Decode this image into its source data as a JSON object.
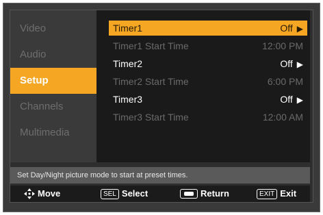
{
  "menu": {
    "items": [
      {
        "label": "Video",
        "active": false
      },
      {
        "label": "Audio",
        "active": false
      },
      {
        "label": "Setup",
        "active": true
      },
      {
        "label": "Channels",
        "active": false
      },
      {
        "label": "Multimedia",
        "active": false
      }
    ]
  },
  "settings": {
    "rows": [
      {
        "label": "Timer1",
        "value": "Off",
        "has_arrow": true,
        "selected": true
      },
      {
        "label": "Timer1 Start Time",
        "value": "12:00 PM",
        "has_arrow": false,
        "selected": false
      },
      {
        "label": "Timer2",
        "value": "Off",
        "has_arrow": true,
        "selected": false
      },
      {
        "label": "Timer2 Start Time",
        "value": "6:00 PM",
        "has_arrow": false,
        "selected": false
      },
      {
        "label": "Timer3",
        "value": "Off",
        "has_arrow": true,
        "selected": false
      },
      {
        "label": "Timer3 Start Time",
        "value": "12:00 AM",
        "has_arrow": false,
        "selected": false
      }
    ]
  },
  "status_text": "Set Day/Night picture mode to start at preset times.",
  "hints": {
    "move_label": "Move",
    "select_key": "SEL",
    "select_label": "Select",
    "return_label": "Return",
    "exit_key": "EXIT",
    "exit_label": "Exit"
  },
  "colors": {
    "accent": "#f5a623",
    "panel_dark": "#1a1a1a",
    "menu_bg": "#3a3a3a"
  }
}
